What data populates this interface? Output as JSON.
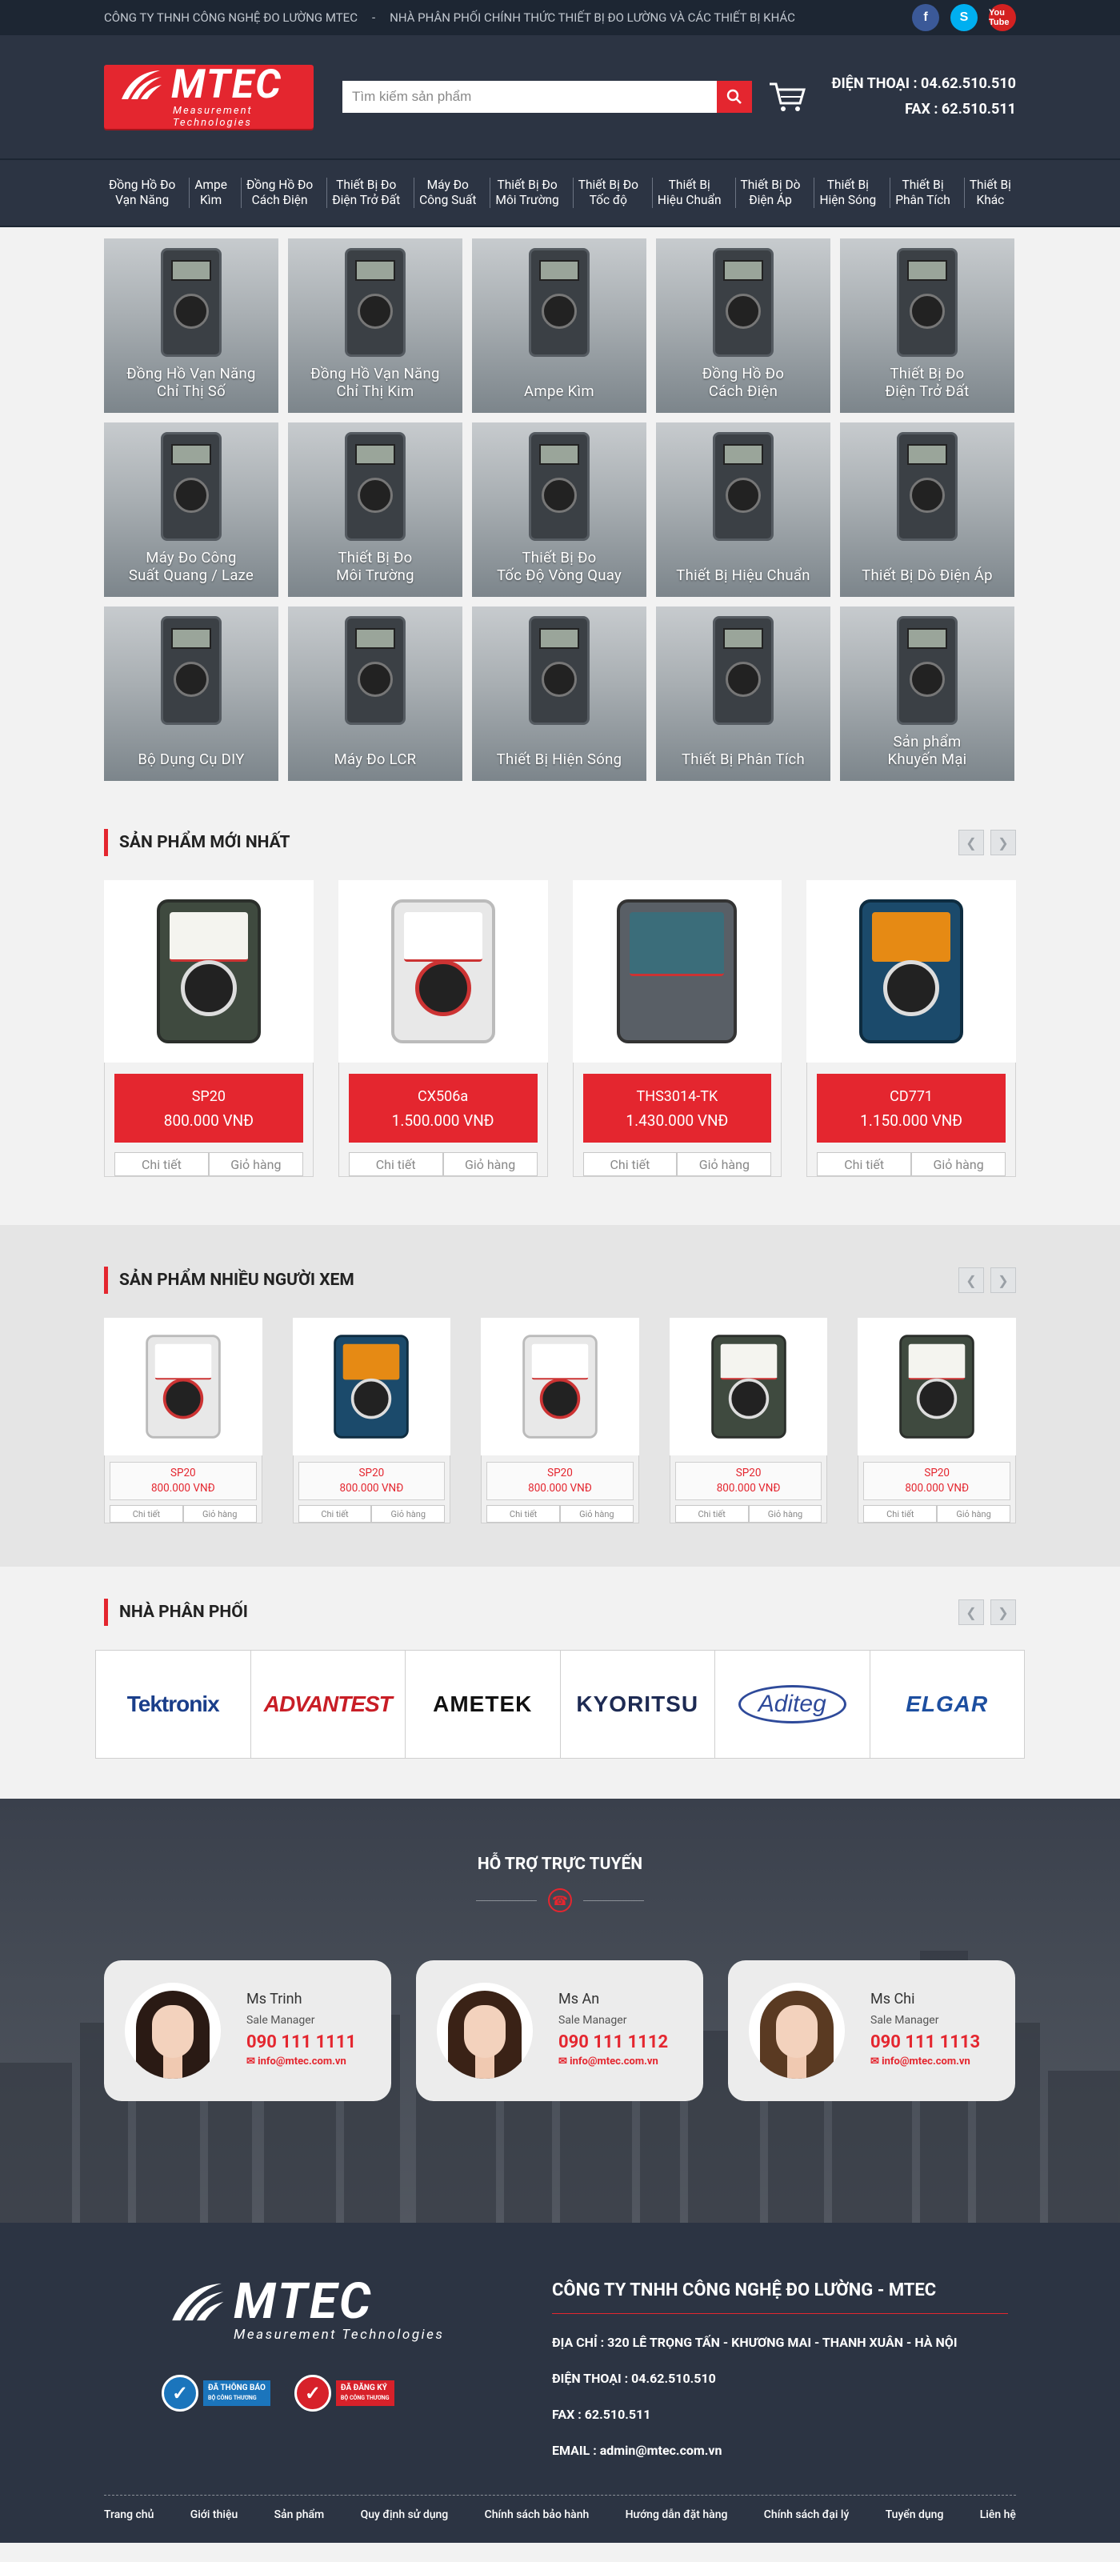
{
  "topbar": {
    "company": "CÔNG TY  THNH CÔNG NGHỆ ĐO LƯỜNG MTEC",
    "sep": "-",
    "tagline": "NHÀ PHÂN PHỐI CHÍNH THỨC THIẾT BỊ ĐO LƯỜNG VÀ CÁC THIẾT BỊ KHÁC",
    "social": [
      "f",
      "S",
      "You Tube"
    ]
  },
  "header": {
    "brand": "MTEC",
    "brand_sub": "Measurement Technologies",
    "search_placeholder": "Tìm kiếm sản phẩm",
    "phone": "ĐIỆN THOẠI : 04.62.510.510",
    "fax": "FAX : 62.510.511"
  },
  "nav": [
    [
      "Đồng Hồ Đo",
      "Vạn Năng"
    ],
    [
      "Ampe",
      "Kìm"
    ],
    [
      "Đồng Hồ Đo",
      "Cách Điện"
    ],
    [
      "Thiết Bị Đo",
      "Điện Trở Đất"
    ],
    [
      "Máy Đo",
      "Công Suất"
    ],
    [
      "Thiết Bị Đo",
      "Môi Trường"
    ],
    [
      "Thiết Bị Đo",
      "Tốc độ"
    ],
    [
      "Thiết Bị",
      "Hiệu Chuẩn"
    ],
    [
      "Thiết Bị Dò",
      "Điện Áp"
    ],
    [
      "Thiết Bị",
      "Hiện Sóng"
    ],
    [
      "Thiết Bị",
      "Phân Tích"
    ],
    [
      "Thiết Bị",
      "Khác"
    ]
  ],
  "categories": [
    [
      "Đồng Hồ Vạn Năng",
      "Chỉ Thị Số"
    ],
    [
      "Đồng Hồ Vạn Năng",
      "Chỉ Thị Kim"
    ],
    [
      "Ampe Kìm"
    ],
    [
      "Đồng Hồ Đo",
      "Cách Điện"
    ],
    [
      "Thiết Bị Đo",
      "Điện Trở Đất"
    ],
    [
      "Máy Đo Công",
      "Suất Quang / Laze"
    ],
    [
      "Thiết Bị Đo",
      "Môi Trường"
    ],
    [
      "Thiết Bị Đo",
      "Tốc Độ Vòng Quay"
    ],
    [
      "Thiết Bị Hiệu Chuẩn"
    ],
    [
      "Thiết Bị Dò Điện Áp"
    ],
    [
      "Bộ Dụng Cụ DIY"
    ],
    [
      "Máy Đo LCR"
    ],
    [
      "Thiết Bị Hiện Sóng"
    ],
    [
      "Thiết Bị Phân Tích"
    ],
    [
      "Sản phẩm",
      "Khuyến Mại"
    ]
  ],
  "new_products": {
    "title": "SẢN PHẨM MỚI NHẤT",
    "items": [
      {
        "name": "SP20",
        "price": "800.000 VNĐ",
        "style": "green"
      },
      {
        "name": "CX506a",
        "price": "1.500.000 VNĐ",
        "style": "red"
      },
      {
        "name": "THS3014-TK",
        "price": "1.430.000 VNĐ",
        "style": "osc"
      },
      {
        "name": "CD771",
        "price": "1.150.000 VNĐ",
        "style": "dig"
      }
    ],
    "detail_label": "Chi tiết",
    "cart_label": "Giỏ hàng"
  },
  "viewed": {
    "title": "SẢN PHẨM NHIỀU NGƯỜI XEM",
    "items": [
      {
        "name": "SP20",
        "price": "800.000 VNĐ",
        "style": "red"
      },
      {
        "name": "SP20",
        "price": "800.000 VNĐ",
        "style": "dig"
      },
      {
        "name": "SP20",
        "price": "800.000 VNĐ",
        "style": "red"
      },
      {
        "name": "SP20",
        "price": "800.000 VNĐ",
        "style": "green"
      },
      {
        "name": "SP20",
        "price": "800.000 VNĐ",
        "style": "green"
      }
    ],
    "detail_label": "Chi tiết",
    "cart_label": "Giỏ hàng"
  },
  "distributors": {
    "title": "NHÀ PHÂN PHỐI",
    "logos": [
      "Tektronix",
      "ADVANTEST",
      "AMETEK",
      "KYORITSU",
      "Aditeg",
      "ELGAR"
    ]
  },
  "support": {
    "title": "HỖ TRỢ TRỰC TUYẾN",
    "agents": [
      {
        "name": "Ms Trinh",
        "role": "Sale Manager",
        "phone": "090 111 1111",
        "email": "info@mtec.com.vn"
      },
      {
        "name": "Ms An",
        "role": "Sale Manager",
        "phone": "090 111 1112",
        "email": "info@mtec.com.vn"
      },
      {
        "name": "Ms Chi",
        "role": "Sale Manager",
        "phone": "090 111 1113",
        "email": "info@mtec.com.vn"
      }
    ]
  },
  "footer": {
    "brand": "MTEC",
    "brand_sub": "Measurement Technologies",
    "badge1": [
      "ĐÃ THÔNG BÁO",
      "BỘ CÔNG THƯƠNG"
    ],
    "badge2": [
      "ĐÃ ĐĂNG KÝ",
      "BỘ CÔNG THƯƠNG"
    ],
    "company": "CÔNG TY TNHH CÔNG NGHỆ ĐO LƯỜNG - MTEC",
    "address": "ĐỊA CHỈ : 320 LÊ TRỌNG TẤN - KHƯƠNG MAI - THANH XUÂN - HÀ NỘI",
    "phone": "ĐIỆN THOẠI : 04.62.510.510",
    "fax": "FAX : 62.510.511",
    "email": "EMAIL : admin@mtec.com.vn",
    "links": [
      "Trang chủ",
      "Giới thiệu",
      "Sản phẩm",
      "Quy định sử dụng",
      "Chính sách bảo hành",
      "Hướng dẫn đặt hàng",
      "Chính sách đại lý",
      "Tuyển dụng",
      "Liên hệ"
    ]
  },
  "colors": {
    "accent": "#e4262f",
    "dark": "#2c3443",
    "topbar": "#1d2633"
  }
}
